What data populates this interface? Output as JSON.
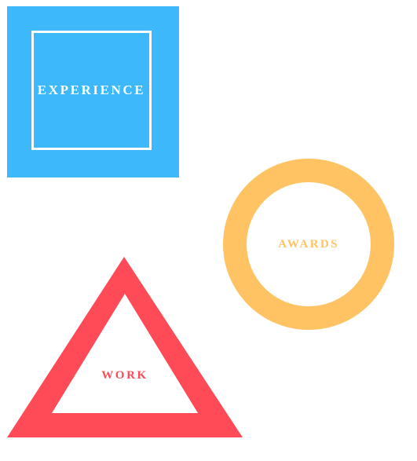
{
  "shapes": {
    "experience": {
      "label": "EXPERIENCE",
      "color": "#3db8fb",
      "shape": "square"
    },
    "awards": {
      "label": "AWARDS",
      "color": "#ffc363",
      "shape": "ring"
    },
    "work": {
      "label": "WORK",
      "color": "#ff4a57",
      "shape": "triangle"
    }
  }
}
